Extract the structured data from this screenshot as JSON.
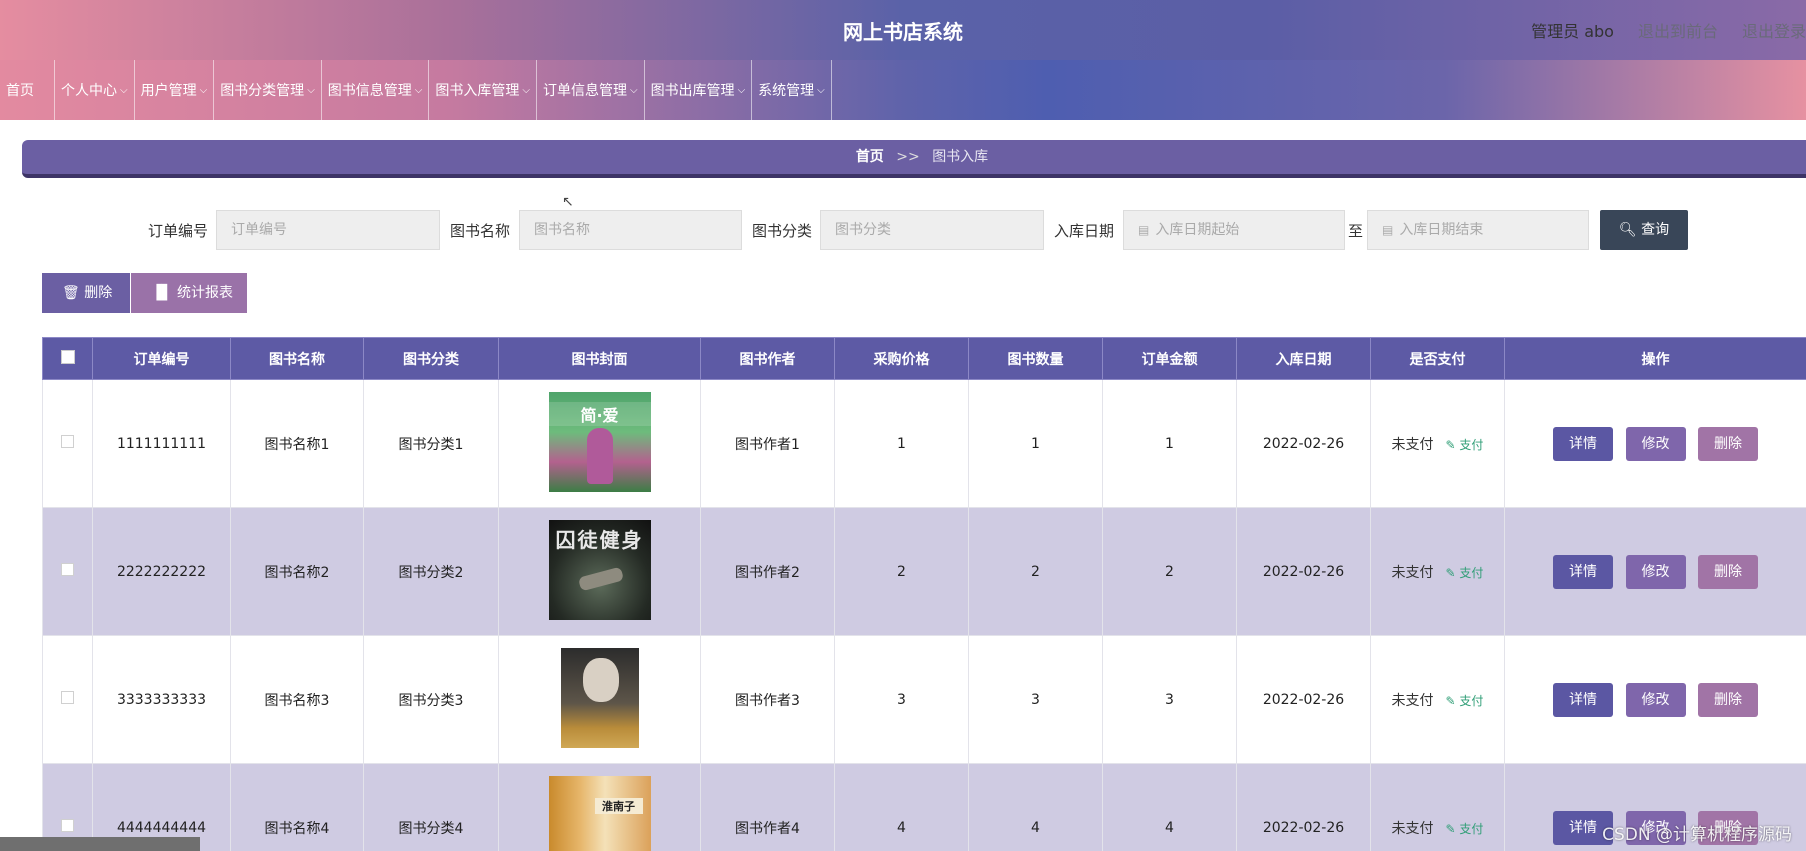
{
  "header": {
    "title": "网上书店系统",
    "admin_label": "管理员 abo",
    "back_to_front": "退出到前台",
    "logout": "退出登录"
  },
  "nav": {
    "items": [
      {
        "label": "首页",
        "dropdown": false
      },
      {
        "label": "个人中心",
        "dropdown": true
      },
      {
        "label": "用户管理",
        "dropdown": true
      },
      {
        "label": "图书分类管理",
        "dropdown": true
      },
      {
        "label": "图书信息管理",
        "dropdown": true
      },
      {
        "label": "图书入库管理",
        "dropdown": true
      },
      {
        "label": "订单信息管理",
        "dropdown": true
      },
      {
        "label": "图书出库管理",
        "dropdown": true
      },
      {
        "label": "系统管理",
        "dropdown": true
      }
    ]
  },
  "breadcrumb": {
    "home": "首页",
    "separator": ">>",
    "current": "图书入库"
  },
  "search": {
    "order_no_label": "订单编号",
    "order_no_placeholder": "订单编号",
    "book_name_label": "图书名称",
    "book_name_placeholder": "图书名称",
    "category_label": "图书分类",
    "category_placeholder": "图书分类",
    "date_label": "入库日期",
    "date_start_placeholder": "入库日期起始",
    "date_to": "至",
    "date_end_placeholder": "入库日期结束",
    "query_button": "查询"
  },
  "actions": {
    "delete_label": "删除",
    "report_label": "统计报表"
  },
  "table": {
    "headers": [
      "订单编号",
      "图书名称",
      "图书分类",
      "图书封面",
      "图书作者",
      "采购价格",
      "图书数量",
      "订单金额",
      "入库日期",
      "是否支付",
      "操作"
    ],
    "rows": [
      {
        "order_no": "1111111111",
        "name": "图书名称1",
        "category": "图书分类1",
        "cover_text": "简·爱",
        "author": "图书作者1",
        "price": "1",
        "qty": "1",
        "amount": "1",
        "date": "2022-02-26",
        "paid": "未支付",
        "pay_link": "支付"
      },
      {
        "order_no": "2222222222",
        "name": "图书名称2",
        "category": "图书分类2",
        "cover_text": "囚徒健身",
        "author": "图书作者2",
        "price": "2",
        "qty": "2",
        "amount": "2",
        "date": "2022-02-26",
        "paid": "未支付",
        "pay_link": "支付"
      },
      {
        "order_no": "3333333333",
        "name": "图书名称3",
        "category": "图书分类3",
        "cover_text": "",
        "author": "图书作者3",
        "price": "3",
        "qty": "3",
        "amount": "3",
        "date": "2022-02-26",
        "paid": "未支付",
        "pay_link": "支付"
      },
      {
        "order_no": "4444444444",
        "name": "图书名称4",
        "category": "图书分类4",
        "cover_text": "淮南子",
        "author": "图书作者4",
        "price": "4",
        "qty": "4",
        "amount": "4",
        "date": "2022-02-26",
        "paid": "未支付",
        "pay_link": "支付"
      }
    ],
    "op_detail": "详情",
    "op_edit": "修改",
    "op_delete": "删除"
  },
  "watermark": "CSDN @计算机程序源码",
  "colors": {
    "primary": "#5d5aa5",
    "query_button": "#394658",
    "pay_link": "#2f9e76",
    "row_alt": "#cfcbe2"
  }
}
